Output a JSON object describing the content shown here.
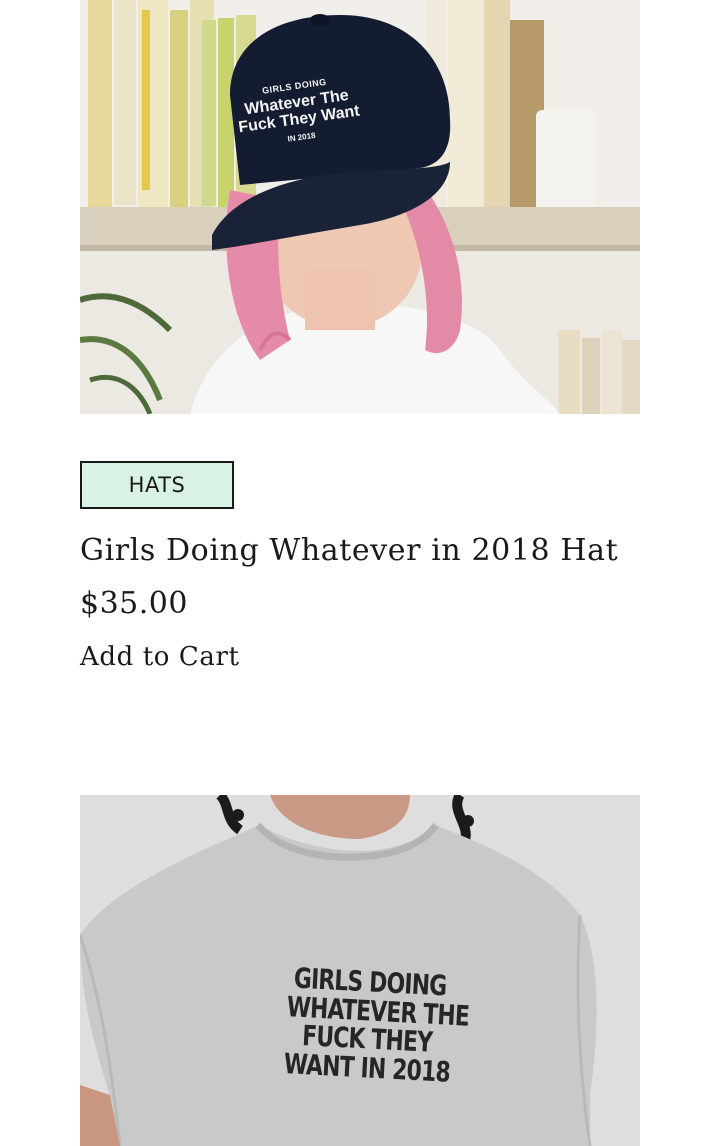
{
  "products": [
    {
      "category": "HATS",
      "title": "Girls Doing Whatever in 2018 Hat",
      "price": "$35.00",
      "cta": "Add to Cart",
      "image_print": [
        "GIRLS DOING",
        "Whatever The",
        "Fuck They Want",
        "IN 2018"
      ]
    },
    {
      "image_print": [
        "GIRLS DOING",
        "WHATEVER THE",
        "FUCK THEY",
        "WANT IN 2018"
      ]
    }
  ],
  "colors": {
    "tag_background": "#d8f3e4",
    "text": "#1a1a1a",
    "cap": "#141c32",
    "hair": "#e48aa8",
    "tee": "#c9c9c9"
  }
}
